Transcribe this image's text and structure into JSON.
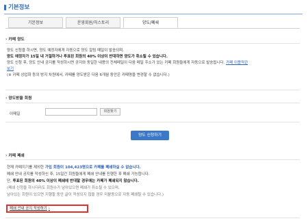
{
  "header": {
    "title": "기본정보"
  },
  "tabs": [
    {
      "label": "기본정보"
    },
    {
      "label": "운영회원/히스토리"
    },
    {
      "label": "양도/폐쇄"
    }
  ],
  "transfer": {
    "heading": "카페 양도",
    "lines": [
      "양도 신청을 하시면, 양도 예정자에게 자동으로 양도 알림 메일이 발송되며,",
      "양도 예정자가 15일 내 거절하거나 투표된 회원의 40% 이상이 반대하면 양도가 취소될 수 있습니다.",
      "양도 신청 후, 양도 안내 공지를 작성하시면 공지와 동일한 내용의 전체메일이 다음 메일 주소가 있는 카페 회원들에게 자동으로 발송됩니다.",
      "카페 이용약관",
      "보기",
      "(※ 카페 상업화 등의 방지 차원에서, 카페를 양도받은 다음 6개월 동안은 카페명을 변경할 수 없습니다.)"
    ]
  },
  "form": {
    "heading": "양도받을 회원",
    "email_label": "이메일",
    "email_value": "",
    "search_button": "회원찾기",
    "submit_button": "양도 신청하기"
  },
  "close": {
    "heading": "카페 폐쇄",
    "line1_pre": "현재 카페지기를 제외한 ",
    "line1_count": "가입 회원이 104,423명으로 카페를 폐쇄하실 수 없습니다.",
    "line2": "폐쇄 안내 공지를 작성하신 후, 15일간 회원들에게 폐쇄 안내를 진행한 후 폐쇄 가능합니다.",
    "line3_pre": "단, ",
    "line3_bold": "투표된 회원의 40% 이상이 폐쇄에 반대할 경우에는 카페가 폐쇄되지 않습니다.",
    "line4": "(폐쇄 신청을 하시더라도 회원수가 남아있으면 폐쇄가 취소될 수 있으며,",
    "line5": "남아있는 회원이 있으면 지행할 동안 글이 작성되지 않을 경우 미활동으로 자동 폐쇄될 수 있습니다.)",
    "guide_link": "폐쇄 안내 공지 작성하기"
  },
  "colors": {
    "accent": "#2f6bbf",
    "button": "#3c78c8",
    "highlight_border": "#e0302a"
  }
}
